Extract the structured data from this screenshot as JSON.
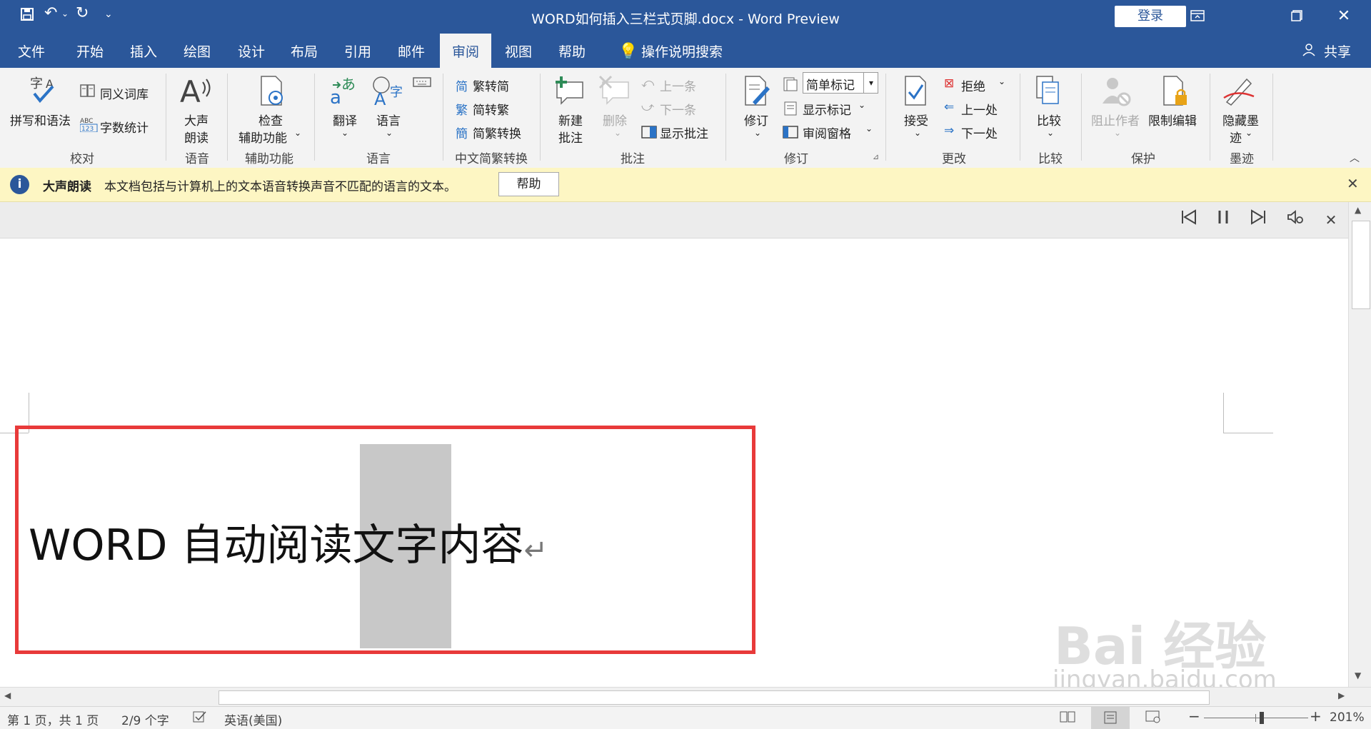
{
  "window": {
    "title": "WORD如何插入三栏式页脚.docx  -  Word Preview",
    "login_label": "登录",
    "share_label": "共享"
  },
  "tabs": [
    {
      "label": "文件"
    },
    {
      "label": "开始"
    },
    {
      "label": "插入"
    },
    {
      "label": "绘图"
    },
    {
      "label": "设计"
    },
    {
      "label": "布局"
    },
    {
      "label": "引用"
    },
    {
      "label": "邮件"
    },
    {
      "label": "审阅",
      "active": true
    },
    {
      "label": "视图"
    },
    {
      "label": "帮助"
    }
  ],
  "tell_me": "操作说明搜索",
  "ribbon": {
    "proofing": {
      "spelling": "拼写和语法",
      "thesaurus": "同义词库",
      "word_count": "字数统计",
      "group": "校对"
    },
    "speech": {
      "read_aloud_1": "大声",
      "read_aloud_2": "朗读",
      "group": "语音"
    },
    "accessibility": {
      "check_1": "检查",
      "check_2": "辅助功能",
      "group": "辅助功能"
    },
    "language": {
      "translate": "翻译",
      "language": "语言",
      "group": "语言"
    },
    "chinese": {
      "t2s": "繁转简",
      "s2t": "简转繁",
      "convert": "简繁转换",
      "group": "中文简繁转换"
    },
    "comments": {
      "new_1": "新建",
      "new_2": "批注",
      "delete": "删除",
      "prev": "上一条",
      "next": "下一条",
      "show": "显示批注",
      "group": "批注"
    },
    "tracking": {
      "track": "修订",
      "markup_select": "简单标记",
      "show_markup": "显示标记",
      "review_pane": "审阅窗格",
      "group": "修订"
    },
    "changes": {
      "accept": "接受",
      "reject": "拒绝",
      "prev": "上一处",
      "next": "下一处",
      "group": "更改"
    },
    "compare": {
      "compare": "比较",
      "group": "比较"
    },
    "protect": {
      "block": "阻止作者",
      "restrict": "限制编辑",
      "group": "保护"
    },
    "ink": {
      "hide_1": "隐藏墨",
      "hide_2": "迹",
      "group": "墨迹"
    }
  },
  "message_bar": {
    "title": "大声朗读",
    "text": "本文档包括与计算机上的文本语音转换声音不匹配的语言的文本。",
    "button": "帮助"
  },
  "document": {
    "text_before": "WORD 自动阅读",
    "text_highlight": "文字",
    "text_after": "内容"
  },
  "watermark": {
    "main": "Bai 经验",
    "sub": "jingyan.baidu.com"
  },
  "status": {
    "page": "第 1 页，共 1 页",
    "words": "2/9 个字",
    "lang": "英语(美国)",
    "zoom": "201%"
  },
  "colors": {
    "brand": "#2b579a",
    "highlight_box": "#e83a3a",
    "read_highlight": "#c8c8c8"
  }
}
